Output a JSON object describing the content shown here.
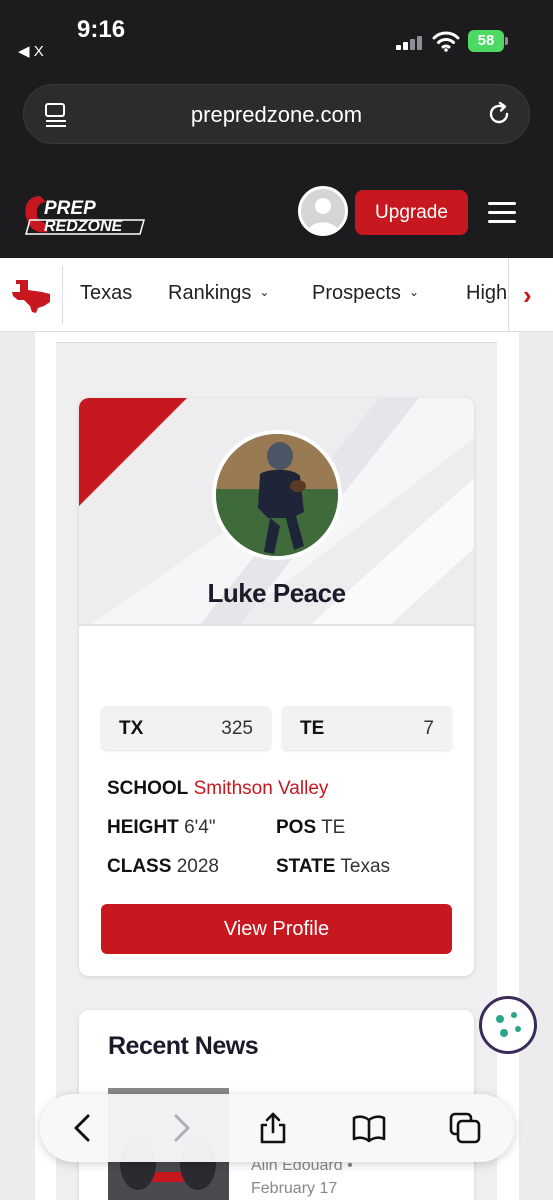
{
  "status_bar": {
    "time": "9:16",
    "back_label": "◀ X",
    "battery": "58"
  },
  "browser": {
    "url": "prepredzone.com"
  },
  "header": {
    "logo_top": "PREP",
    "logo_bottom": "REDZONE",
    "upgrade_label": "Upgrade",
    "accent_color": "#c8181f"
  },
  "nav": {
    "items": [
      {
        "label": "Texas",
        "has_dropdown": false
      },
      {
        "label": "Rankings",
        "has_dropdown": true
      },
      {
        "label": "Prospects",
        "has_dropdown": true
      },
      {
        "label": "High",
        "has_dropdown": false
      }
    ]
  },
  "profile": {
    "name": "Luke Peace",
    "stats": [
      {
        "key": "TX",
        "value": "325"
      },
      {
        "key": "TE",
        "value": "7"
      }
    ],
    "school_label": "SCHOOL",
    "school_value": "Smithson Valley",
    "height_label": "HEIGHT",
    "height_value": "6'4\"",
    "pos_label": "POS",
    "pos_value": "TE",
    "class_label": "CLASS",
    "class_value": "2028",
    "state_label": "STATE",
    "state_value": "Texas",
    "view_profile_label": "View Profile"
  },
  "news": {
    "title": "Recent News",
    "items": [
      {
        "author": "Alin Edouard •",
        "date": "February 17"
      }
    ]
  }
}
